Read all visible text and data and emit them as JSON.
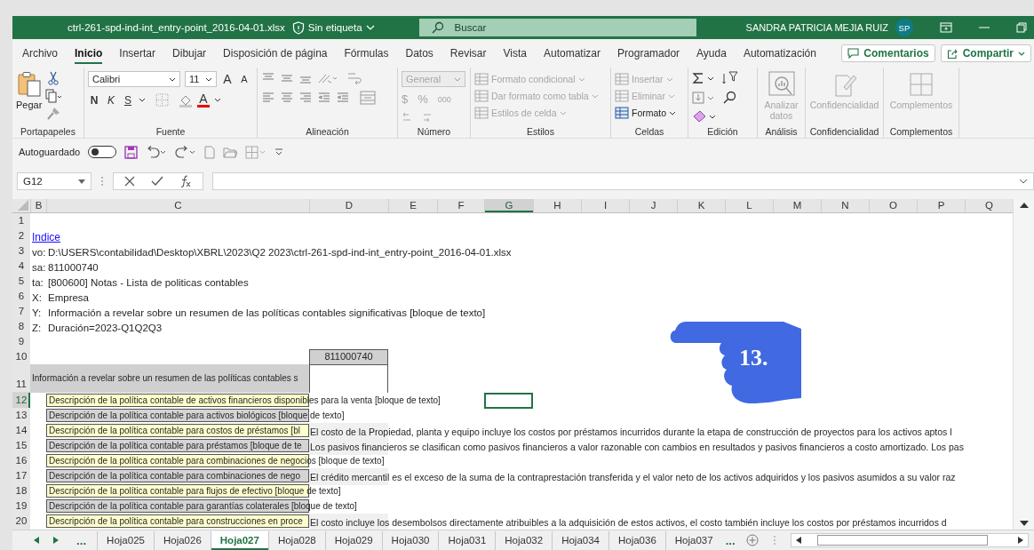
{
  "title_bar": {
    "file_name": "ctrl-261-spd-ind-int_entry-point_2016-04-01.xlsx",
    "label": "Sin etiqueta",
    "search_placeholder": "Buscar",
    "user": "SANDRA PATRICIA MEJIA RUIZ",
    "avatar": "SP"
  },
  "menu_tabs": [
    {
      "label": "Archivo",
      "selected": false
    },
    {
      "label": "Inicio",
      "selected": true
    },
    {
      "label": "Insertar",
      "selected": false
    },
    {
      "label": "Dibujar",
      "selected": false
    },
    {
      "label": "Disposición de página",
      "selected": false
    },
    {
      "label": "Fórmulas",
      "selected": false
    },
    {
      "label": "Datos",
      "selected": false
    },
    {
      "label": "Revisar",
      "selected": false
    },
    {
      "label": "Vista",
      "selected": false
    },
    {
      "label": "Automatizar",
      "selected": false
    },
    {
      "label": "Programador",
      "selected": false
    },
    {
      "label": "Ayuda",
      "selected": false
    },
    {
      "label": "Automatización",
      "selected": false
    }
  ],
  "menu_buttons": {
    "comments": "Comentarios",
    "share": "Compartir"
  },
  "ribbon": {
    "groups": [
      {
        "kind": "clipboard",
        "label": "Portapapeles",
        "items": [
          {
            "label": "Pegar"
          }
        ]
      },
      {
        "kind": "font",
        "label": "Fuente",
        "font": "Calibri",
        "size": "11",
        "glyphs": [
          {
            "label": "A",
            "kind": "grow"
          },
          {
            "label": "A",
            "kind": "shrink"
          },
          {
            "label": "N",
            "kind": "bold"
          },
          {
            "label": "K",
            "kind": "italic"
          },
          {
            "label": "S",
            "kind": "underline"
          },
          {
            "label": "A",
            "kind": "color"
          }
        ]
      },
      {
        "kind": "alignment",
        "label": "Alineación"
      },
      {
        "kind": "number",
        "label": "Número",
        "format": "General",
        "disabled": true,
        "glyphs": [
          {
            "label": "$",
            "kind": "currency"
          },
          {
            "label": "%",
            "kind": "percent"
          },
          {
            "label": "000",
            "kind": "thousands"
          }
        ]
      },
      {
        "kind": "styles",
        "label": "Estilos",
        "items": [
          {
            "label": "Formato condicional",
            "disabled": true
          },
          {
            "label": "Dar formato como tabla",
            "disabled": true
          },
          {
            "label": "Estilos de celda",
            "disabled": true
          }
        ]
      },
      {
        "kind": "cells",
        "label": "Celdas",
        "items": [
          {
            "label": "Insertar",
            "disabled": true
          },
          {
            "label": "Eliminar",
            "disabled": true
          },
          {
            "label": "Formato",
            "disabled": false
          }
        ]
      },
      {
        "kind": "editing",
        "label": "Edición"
      },
      {
        "kind": "large",
        "label": "Análisis",
        "items": [
          {
            "label": "Analizar datos",
            "disabled": true
          }
        ]
      },
      {
        "kind": "large",
        "label": "Confidencialidad",
        "items": [
          {
            "label": "Confidencialidad",
            "disabled": true
          }
        ]
      },
      {
        "kind": "large",
        "label": "Complementos",
        "items": [
          {
            "label": "Complementos",
            "disabled": true
          }
        ]
      }
    ]
  },
  "quick_access": {
    "autosave_label": "Autoguardado",
    "autosave_on": false
  },
  "formula_bar": {
    "name_box": "G12"
  },
  "sheet": {
    "columns": [
      {
        "label": "B",
        "selected": false
      },
      {
        "label": "C",
        "selected": false
      },
      {
        "label": "D",
        "selected": false
      },
      {
        "label": "E",
        "selected": false
      },
      {
        "label": "F",
        "selected": false
      },
      {
        "label": "G",
        "selected": true
      },
      {
        "label": "H",
        "selected": false
      },
      {
        "label": "I",
        "selected": false
      },
      {
        "label": "J",
        "selected": false
      },
      {
        "label": "K",
        "selected": false
      },
      {
        "label": "L",
        "selected": false
      },
      {
        "label": "M",
        "selected": false
      },
      {
        "label": "N",
        "selected": false
      },
      {
        "label": "O",
        "selected": false
      },
      {
        "label": "P",
        "selected": false
      },
      {
        "label": "Q",
        "selected": false
      }
    ],
    "rows": [
      {
        "number": "1",
        "selected": false,
        "kind": "blank"
      },
      {
        "number": "2",
        "selected": false,
        "kind": "link",
        "b": "Indice"
      },
      {
        "number": "3",
        "selected": false,
        "kind": "meta",
        "b": "vo:",
        "c": "D:\\USERS\\contabilidad\\Desktop\\XBRL\\2023\\Q2 2023\\ctrl-261-spd-ind-int_entry-point_2016-04-01.xlsx"
      },
      {
        "number": "4",
        "selected": false,
        "kind": "meta",
        "b": "sa:",
        "c": "811000740"
      },
      {
        "number": "5",
        "selected": false,
        "kind": "meta",
        "b": "ta:",
        "c": "[800600] Notas - Lista de politicas contables"
      },
      {
        "number": "6",
        "selected": false,
        "kind": "meta",
        "b": "X:",
        "c": "Empresa"
      },
      {
        "number": "7",
        "selected": false,
        "kind": "meta",
        "b": "Y:",
        "c": "Información a revelar sobre un resumen de las políticas contables significativas [bloque de texto]"
      },
      {
        "number": "8",
        "selected": false,
        "kind": "meta",
        "b": "Z:",
        "c": "Duración=2023-Q1Q2Q3"
      },
      {
        "number": "9",
        "selected": false,
        "kind": "blank"
      },
      {
        "number": "10",
        "selected": false,
        "kind": "header",
        "d": "811000740"
      },
      {
        "number": "11",
        "selected": false,
        "kind": "section",
        "c": "Información a revelar sobre un resumen de las políticas contables s"
      },
      {
        "number": "12",
        "selected": true,
        "kind": "item",
        "color": "#ffffcc",
        "c": "Descripción de la política contable de activos financieros disponibles para la venta [bloque de texto]"
      },
      {
        "number": "13",
        "selected": false,
        "kind": "item",
        "color": "#d4d4d4",
        "c": "Descripción de la política contable para activos biológicos [bloque de texto]"
      },
      {
        "number": "14",
        "selected": false,
        "kind": "item",
        "color": "#ffffcc",
        "c": "Descripción de la política contable para costos de préstamos [bl",
        "d": "El costo de la Propiedad, planta y equipo incluye los costos por préstamos incurridos durante la etapa de construcción de proyectos para los activos aptos l"
      },
      {
        "number": "15",
        "selected": false,
        "kind": "item",
        "color": "#d4d4d4",
        "c": "Descripción de la política contable para préstamos [bloque de te",
        "d": "Los pasivos financieros se clasifican como pasivos financieros a valor razonable con cambios en resultados y pasivos financieros a costo amortizado. Los pas"
      },
      {
        "number": "16",
        "selected": false,
        "kind": "item",
        "color": "#ffffcc",
        "c": "Descripción de la política contable para combinaciones de negocios [bloque de texto]"
      },
      {
        "number": "17",
        "selected": false,
        "kind": "item",
        "color": "#d4d4d4",
        "c": "Descripción de la política contable para combinaciones de nego",
        "d": "El crédito mercantil es el exceso de la suma de la contraprestación transferida y el valor neto de los activos adquiridos y los pasivos asumidos a su valor raz"
      },
      {
        "number": "18",
        "selected": false,
        "kind": "item",
        "color": "#ffffcc",
        "c": "Descripción de la política contable para flujos de efectivo [bloque de texto]"
      },
      {
        "number": "19",
        "selected": false,
        "kind": "item",
        "color": "#d4d4d4",
        "c": "Descripción de la política contable para garantías colaterales [bloque de texto]"
      },
      {
        "number": "20",
        "selected": false,
        "kind": "item",
        "color": "#ffffcc",
        "c": "Descripción de la política contable para construcciones en proce",
        "d": "El costo incluye los desembolsos directamente atribuibles a la adquisición de estos activos, el costo también incluye los costos por préstamos incurridos d"
      }
    ],
    "callout": "13."
  },
  "sheet_tabs": {
    "more_left": "...",
    "more_right": "...",
    "tabs": [
      {
        "label": "Hoja025",
        "selected": false
      },
      {
        "label": "Hoja026",
        "selected": false
      },
      {
        "label": "Hoja027",
        "selected": true
      },
      {
        "label": "Hoja028",
        "selected": false
      },
      {
        "label": "Hoja029",
        "selected": false
      },
      {
        "label": "Hoja030",
        "selected": false
      },
      {
        "label": "Hoja031",
        "selected": false
      },
      {
        "label": "Hoja032",
        "selected": false
      },
      {
        "label": "Hoja034",
        "selected": false
      },
      {
        "label": "Hoja036",
        "selected": false
      },
      {
        "label": "Hoja037",
        "selected": false
      }
    ]
  }
}
